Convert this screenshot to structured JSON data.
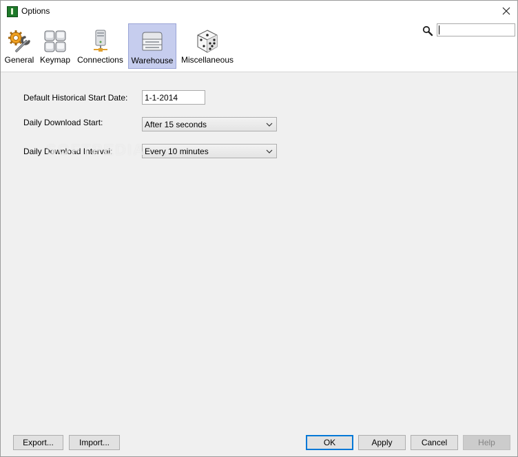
{
  "window": {
    "title": "Options"
  },
  "toolbar": {
    "items": [
      {
        "label": "General",
        "icon": "gear-wrench-icon"
      },
      {
        "label": "Keymap",
        "icon": "keyboard-keys-icon"
      },
      {
        "label": "Connections",
        "icon": "network-computer-icon"
      },
      {
        "label": "Warehouse",
        "icon": "storage-drive-icon",
        "selected": true
      },
      {
        "label": "Miscellaneous",
        "icon": "dice-icon"
      }
    ],
    "search": {
      "value": "",
      "icon": "search-icon"
    }
  },
  "form": {
    "start_date": {
      "label": "Default Historical Start Date:",
      "value": "1-1-2014"
    },
    "download_start": {
      "label": "Daily Download Start:",
      "value": "After 15 seconds"
    },
    "download_interval": {
      "label": "Daily Download Interval:",
      "value": "Every 10 minutes"
    }
  },
  "watermark": "SOFTPEDIA",
  "buttons": {
    "export": "Export...",
    "import": "Import...",
    "ok": "OK",
    "apply": "Apply",
    "cancel": "Cancel",
    "help": "Help"
  },
  "colors": {
    "selected_tab_bg": "#c6cdee",
    "default_button_border": "#0078d7",
    "app_icon": "#1e7a2a"
  }
}
